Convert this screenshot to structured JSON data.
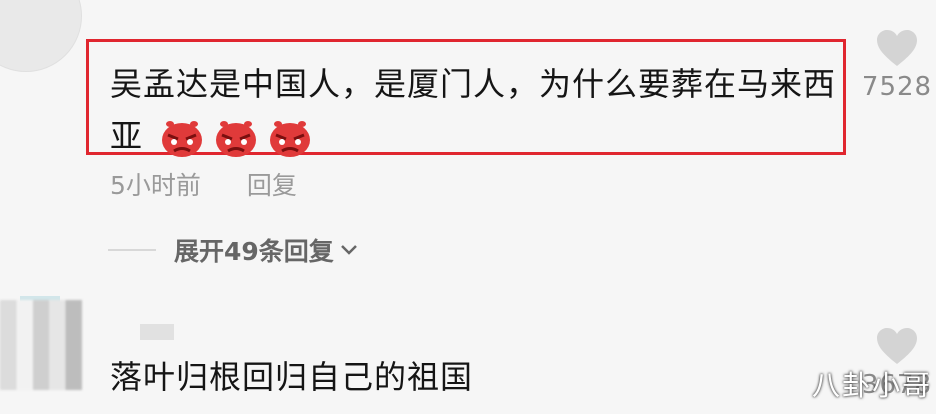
{
  "comment1": {
    "text": "吴孟达是中国人，是厦门人，为什么要葬在马来西亚",
    "emoji_icon": "angry-face-icon",
    "emoji_count": 3,
    "like_count": "7528",
    "time": "5小时前",
    "reply_label": "回复",
    "expand_label": "展开49条回复"
  },
  "comment2": {
    "text": "落叶归根回归自己的祖国",
    "like_count": "3678"
  },
  "watermark": "八卦小哥",
  "colors": {
    "highlight": "#e0262f",
    "heart": "#d4d4d4",
    "emoji": "#e03a3a"
  }
}
